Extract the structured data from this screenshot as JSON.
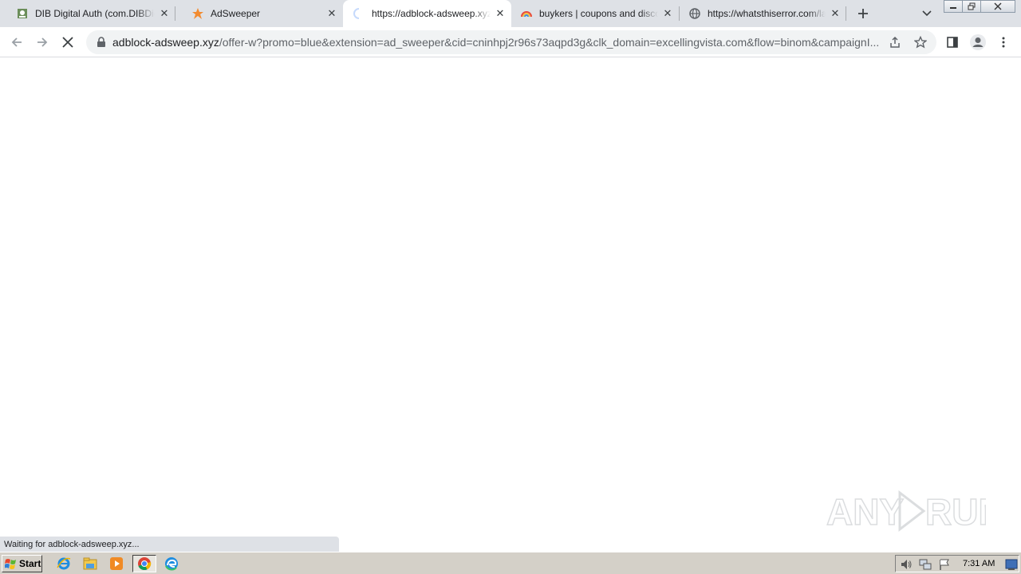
{
  "tabs": [
    {
      "title": "DIB Digital Auth (com.DIBDigitalAuth)",
      "favicon": "dib-favicon-icon",
      "active": false
    },
    {
      "title": "AdSweeper",
      "favicon": "adsweeper-favicon-icon",
      "active": false
    },
    {
      "title": "https://adblock-adsweep.xyz/offer-w",
      "favicon": "loading-spinner-icon",
      "active": true
    },
    {
      "title": "buykers | coupons and discounts",
      "favicon": "buykers-favicon-icon",
      "active": false
    },
    {
      "title": "https://whatsthiserror.com/landing",
      "favicon": "globe-icon",
      "active": false
    }
  ],
  "address_bar": {
    "host": "adblock-adsweep.xyz",
    "path": "/offer-w?promo=blue&extension=ad_sweeper&cid=cninhpj2r96s73aqpd3g&clk_domain=excellingvista.com&flow=binom&campaignI..."
  },
  "status_text": "Waiting for adblock-adsweep.xyz...",
  "watermark": "ANY RUN",
  "taskbar": {
    "start_label": "Start",
    "clock": "7:31 AM"
  },
  "colors": {
    "tabstrip": "#dee1e6",
    "omnibox": "#f1f3f4",
    "taskbar": "#d4d0c8"
  }
}
